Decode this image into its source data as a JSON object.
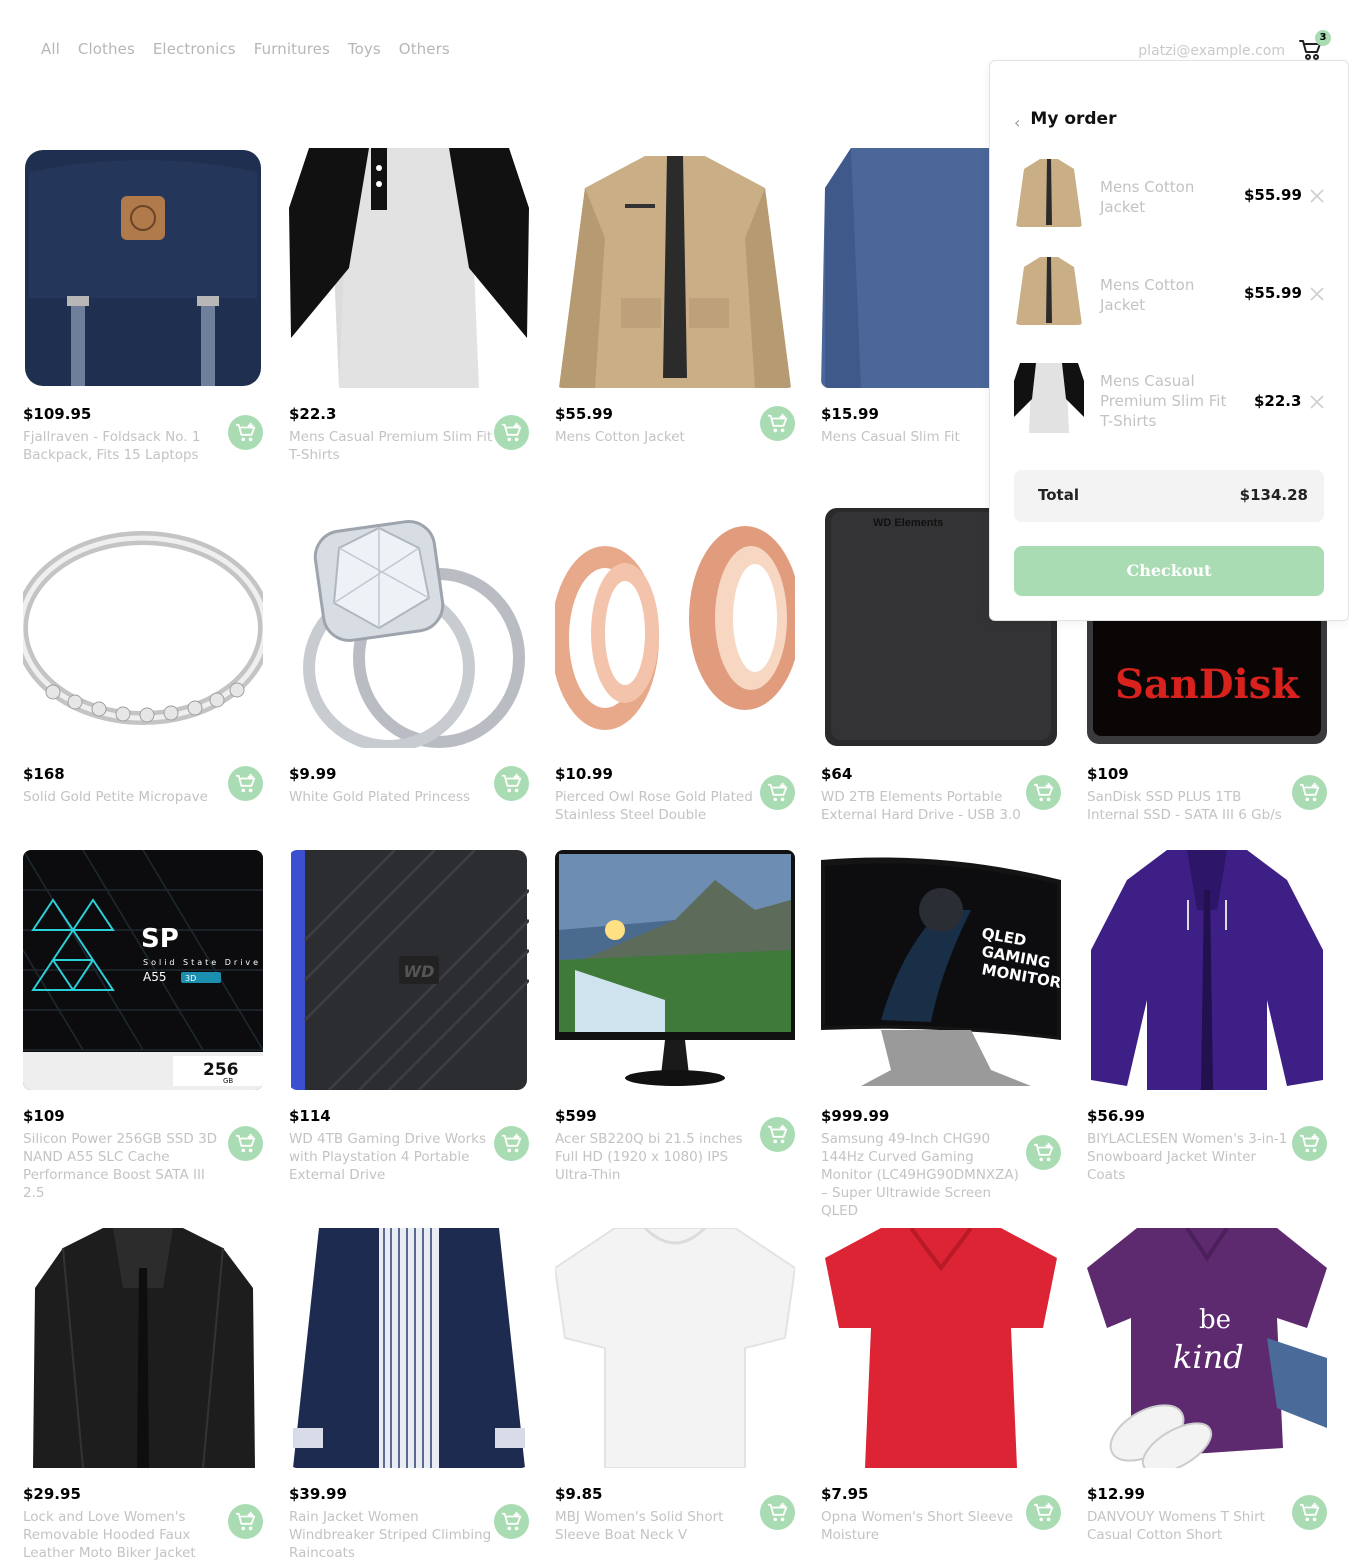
{
  "nav": {
    "links": [
      "All",
      "Clothes",
      "Electronics",
      "Furnitures",
      "Toys",
      "Others"
    ],
    "email": "platzi@example.com",
    "cart_count": "3"
  },
  "products": [
    {
      "price": "$109.95",
      "name": "Fjallraven - Foldsack No. 1 Backpack, Fits 15 Laptops",
      "image": "backpack"
    },
    {
      "price": "$22.3",
      "name": "Mens Casual Premium Slim Fit T-Shirts",
      "image": "raglan-tshirt"
    },
    {
      "price": "$55.99",
      "name": "Mens Cotton Jacket",
      "image": "cotton-jacket"
    },
    {
      "price": "$15.99",
      "name": "Mens Casual Slim Fit",
      "image": "blue-longsleeve"
    },
    {
      "price": "",
      "name": "",
      "image": "hidden"
    },
    {
      "price": "$168",
      "name": "Solid Gold Petite Micropave",
      "image": "silver-band-ring"
    },
    {
      "price": "$9.99",
      "name": "White Gold Plated Princess",
      "image": "diamond-ring"
    },
    {
      "price": "$10.99",
      "name": "Pierced Owl Rose Gold Plated Stainless Steel Double",
      "image": "rose-gold-plugs"
    },
    {
      "price": "$64",
      "name": "WD 2TB Elements Portable External Hard Drive - USB 3.0",
      "image": "wd-elements-drive"
    },
    {
      "price": "$109",
      "name": "SanDisk SSD PLUS 1TB Internal SSD - SATA III 6 Gb/s",
      "image": "sandisk-ssd"
    },
    {
      "price": "$109",
      "name": "Silicon Power 256GB SSD 3D NAND A55 SLC Cache Performance Boost SATA III 2.5",
      "image": "sp-ssd"
    },
    {
      "price": "$114",
      "name": "WD 4TB Gaming Drive Works with Playstation 4 Portable External Drive",
      "image": "wd-gaming-drive"
    },
    {
      "price": "$599",
      "name": "Acer SB220Q bi 21.5 inches Full HD (1920 x 1080) IPS Ultra-Thin",
      "image": "acer-monitor"
    },
    {
      "price": "$999.99",
      "name": "Samsung 49-Inch CHG90 144Hz Curved Gaming Monitor (LC49HG90DMNXZA) – Super Ultrawide Screen QLED",
      "image": "samsung-monitor"
    },
    {
      "price": "$56.99",
      "name": "BIYLACLESEN Women's 3-in-1 Snowboard Jacket Winter Coats",
      "image": "purple-jacket"
    },
    {
      "price": "$29.95",
      "name": "Lock and Love Women's Removable Hooded Faux Leather Moto Biker Jacket",
      "image": "leather-jacket"
    },
    {
      "price": "$39.99",
      "name": "Rain Jacket Women Windbreaker Striped Climbing Raincoats",
      "image": "navy-raincoat"
    },
    {
      "price": "$9.85",
      "name": "MBJ Women's Solid Short Sleeve Boat Neck V",
      "image": "white-top"
    },
    {
      "price": "$7.95",
      "name": "Opna Women's Short Sleeve Moisture",
      "image": "red-tshirt"
    },
    {
      "price": "$12.99",
      "name": "DANVOUY Womens T Shirt Casual Cotton Short",
      "image": "purple-tshirt"
    }
  ],
  "image_text": {
    "wd_elements": "WD Elements",
    "sandisk": "SanDisk",
    "sp_logo": "SP",
    "sp_subtitle": "Solid State Drive",
    "sp_model": "A55",
    "sp_3d": "3D",
    "sp_capacity": "256",
    "sp_unit": "GB",
    "wd_logo": "WD",
    "monitor_text": [
      "QLED",
      "GAMING",
      "MONITOR"
    ],
    "shirt_text": [
      "be",
      "kind"
    ]
  },
  "order": {
    "title": "My order",
    "items": [
      {
        "name": "Mens Cotton Jacket",
        "price": "$55.99",
        "image": "cotton-jacket"
      },
      {
        "name": "Mens Cotton Jacket",
        "price": "$55.99",
        "image": "cotton-jacket"
      },
      {
        "name": "Mens Casual Premium Slim Fit T-Shirts",
        "price": "$22.3",
        "image": "raglan-tshirt"
      }
    ],
    "total_label": "Total",
    "total_value": "$134.28",
    "checkout_label": "Checkout"
  },
  "colors": {
    "accent": "#a9dcb3",
    "muted_text": "#c3c3c3",
    "nav_text": "#b7b7b7"
  }
}
